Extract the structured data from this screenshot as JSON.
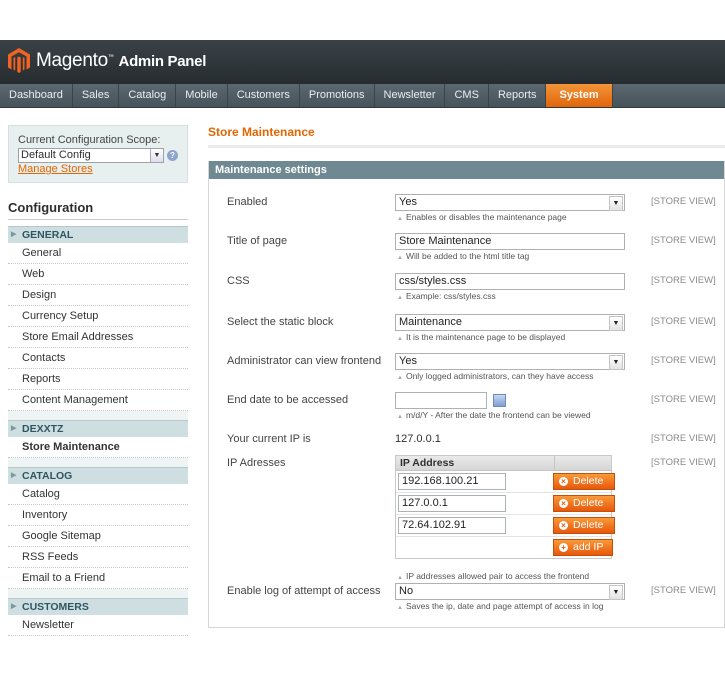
{
  "header": {
    "brand_main": "Magento",
    "brand_sub": "Admin Panel"
  },
  "nav": {
    "items": [
      "Dashboard",
      "Sales",
      "Catalog",
      "Mobile",
      "Customers",
      "Promotions",
      "Newsletter",
      "CMS",
      "Reports",
      "System"
    ],
    "active_index": 9
  },
  "sidebar": {
    "scope_label": "Current Configuration Scope:",
    "scope_value": "Default Config",
    "manage_stores": "Manage Stores",
    "title": "Configuration",
    "groups": [
      {
        "title": "GENERAL",
        "items": [
          "General",
          "Web",
          "Design",
          "Currency Setup",
          "Store Email Addresses",
          "Contacts",
          "Reports",
          "Content Management"
        ]
      },
      {
        "title": "DEXXTZ",
        "items": [
          "Store Maintenance"
        ]
      },
      {
        "title": "CATALOG",
        "items": [
          "Catalog",
          "Inventory",
          "Google Sitemap",
          "RSS Feeds",
          "Email to a Friend"
        ]
      },
      {
        "title": "CUSTOMERS",
        "items": [
          "Newsletter"
        ]
      }
    ]
  },
  "main": {
    "page_title": "Store Maintenance",
    "section_title": "Maintenance settings",
    "store_view": "[STORE VIEW]",
    "fields": {
      "enabled": {
        "label": "Enabled",
        "value": "Yes",
        "note": "Enables or disables the maintenance page"
      },
      "title": {
        "label": "Title of page",
        "value": "Store Maintenance",
        "note": "Will be added to the html title tag"
      },
      "css": {
        "label": "CSS",
        "value": "css/styles.css",
        "note": "Example: css/styles.css"
      },
      "block": {
        "label": "Select the static block",
        "value": "Maintenance",
        "note": "It is the maintenance page to be displayed"
      },
      "admin": {
        "label": "Administrator can view frontend",
        "value": "Yes",
        "note": "Only logged administrators, can they have access"
      },
      "end_date": {
        "label": "End date to be accessed",
        "value": "",
        "note": "m/d/Y - After the date the frontend can be viewed"
      },
      "current_ip": {
        "label": "Your current IP is",
        "value": "127.0.0.1"
      },
      "ip_addresses": {
        "label": "IP Adresses",
        "column": "IP Address",
        "rows": [
          "192.168.100.21",
          "127.0.0.1",
          "72.64.102.91"
        ],
        "delete_label": "Delete",
        "add_label": "add IP",
        "note": "IP addresses allowed pair to access the frontend"
      },
      "log": {
        "label": "Enable log of attempt of access",
        "value": "No",
        "note": "Saves the ip, date and page attempt of access in log"
      }
    }
  }
}
